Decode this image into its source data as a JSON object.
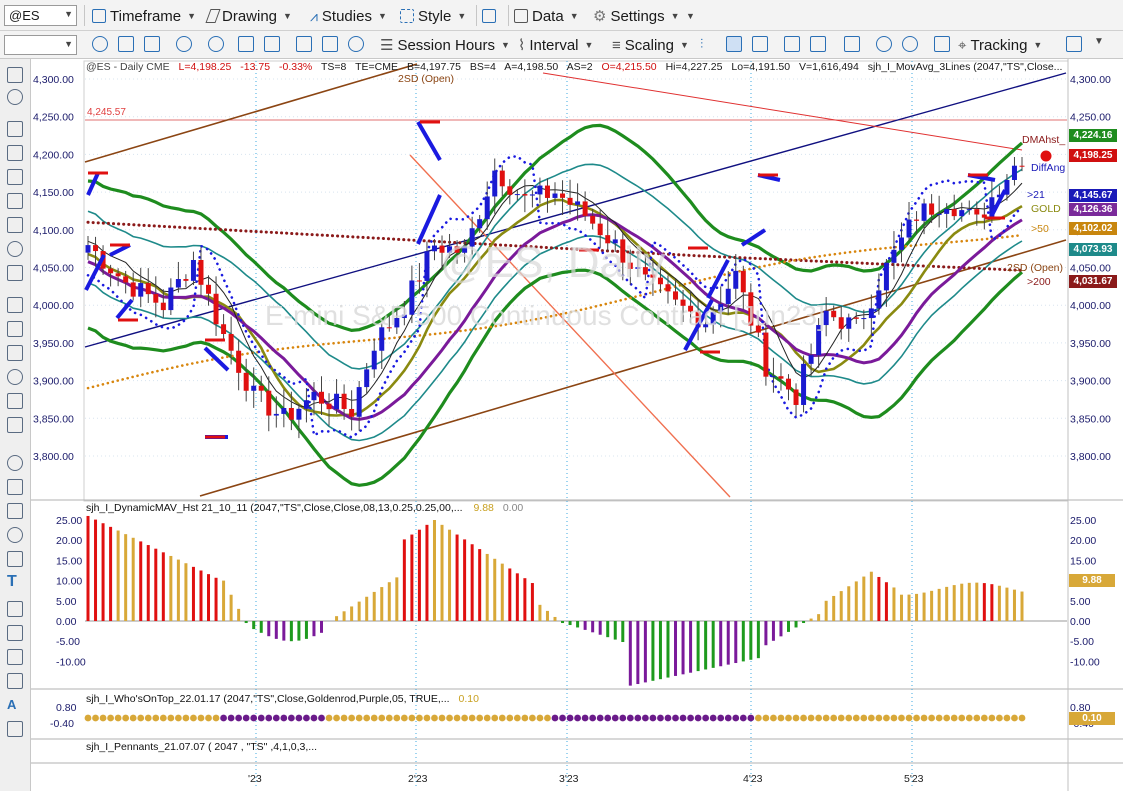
{
  "toolbar": {
    "symbol": "@ES",
    "timeframe": "Timeframe",
    "drawing": "Drawing",
    "studies": "Studies",
    "style": "Style",
    "data": "Data",
    "settings": "Settings",
    "session_hours": "Session Hours",
    "interval": "Interval",
    "scaling": "Scaling",
    "tracking": "Tracking"
  },
  "header": {
    "symbol_info": "@ES - Daily  CME",
    "last": "L=4,198.25",
    "change": "-13.75",
    "change_pct": "-0.33%",
    "ts": "TS=8",
    "te": "TE=CME",
    "bid": "B=4,197.75",
    "bs": "BS=4",
    "ask": "A=4,198.50",
    "as": "AS=2",
    "open": "O=4,215.50",
    "high": "Hi=4,227.25",
    "low": "Lo=4,191.50",
    "volume": "V=1,616,494",
    "study": "sjh_I_MovAvg_3Lines (2047,\"TS\",Close..."
  },
  "labels": {
    "twosd_top": "2SD (Open)",
    "twosd_right": "2SD (Open)",
    "level_line": "4,245.57",
    "dmahst": "DMAhst_",
    "diffang": "DiffAng",
    "ma21": ">21",
    "gold": "GOLD",
    "ma50": ">50",
    "ma200": ">200",
    "watermark": "@ES, Daily",
    "watermark2": "E-mini S&P 500 Continuous Contract [Jun23]"
  },
  "price_axis": [
    "4,300.00",
    "4,250.00",
    "4,200.00",
    "4,150.00",
    "4,100.00",
    "4,050.00",
    "4,000.00",
    "3,950.00",
    "3,900.00",
    "3,850.00",
    "3,800.00"
  ],
  "price_tags": [
    {
      "text": "4,224.16",
      "color": "#1e8c1e"
    },
    {
      "text": "4,198.25",
      "color": "#d01010"
    },
    {
      "text": "4,145.67",
      "color": "#1a1ab8"
    },
    {
      "text": "4,126.36",
      "color": "#7a2a9a"
    },
    {
      "text": "4,102.02",
      "color": "#c8860e"
    },
    {
      "text": "4,073.93",
      "color": "#1e8a8a"
    },
    {
      "text": "4,031.67",
      "color": "#8b1a1a"
    }
  ],
  "hist_panel": {
    "title": "sjh_I_DynamicMAV_Hst 21_10_11 (2047,\"TS\",Close,Close,08,13,0.25,0.25,00,...",
    "val1": "9.88",
    "val2": "0.00",
    "axis": [
      "25.00",
      "20.00",
      "15.00",
      "10.00",
      "5.00",
      "0.00",
      "-5.00",
      "-10.00"
    ],
    "tag": "9.88"
  },
  "wot_panel": {
    "title": "sjh_I_Who'sOnTop_22.01.17 (2047,\"TS\",Close,Goldenrod,Purple,05, TRUE,...",
    "val": "0.10",
    "axis": [
      "0.80",
      "-0.40"
    ],
    "tag": "0.10"
  },
  "pennants_panel": {
    "title": "sjh_I_Pennants_21.07.07 ( 2047 , \"TS\" ,4,1,0,3,..."
  },
  "time_axis": [
    "'23",
    "2'23",
    "3'23",
    "4'23",
    "5'23"
  ],
  "colors": {
    "up": "#1a1ad0",
    "down": "#e01010",
    "green_band": "#1e8c1e",
    "teal_band": "#1e8a8a",
    "gold": "#8a8a10",
    "purple": "#7a1a9a",
    "orange_dots": "#d8860e",
    "darkred_dots": "#8b1a1a",
    "blue_dots": "#1a1ae0",
    "brown_channel": "#8b4513",
    "navy_line": "#101080"
  },
  "chart_data": {
    "type": "candlestick",
    "symbol": "@ES",
    "ylim": [
      3760,
      4320
    ]
  }
}
